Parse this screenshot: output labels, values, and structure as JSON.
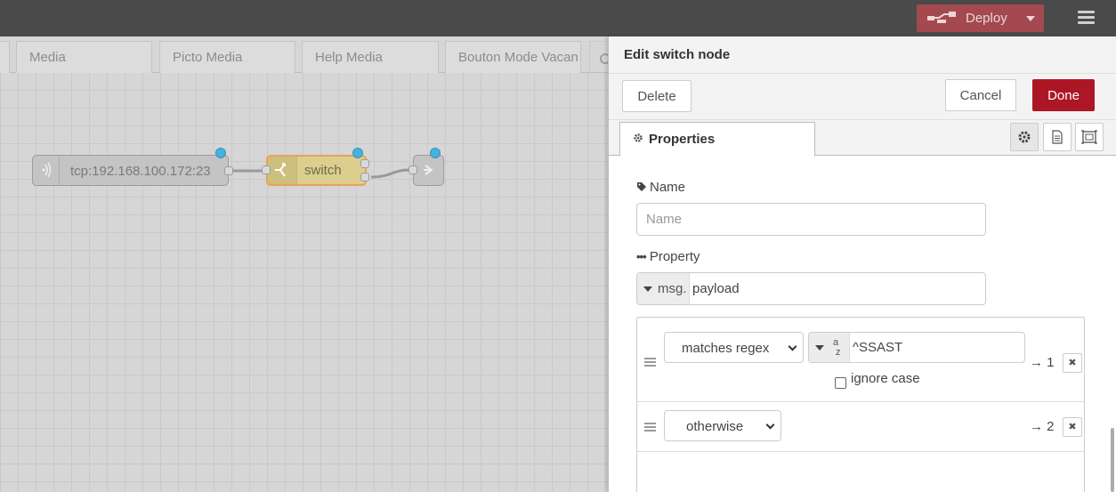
{
  "header": {
    "deploy_label": "Deploy"
  },
  "workspace": {
    "tabs": [
      "Media",
      "Picto Media",
      "Help Media",
      "Bouton Mode Vacan"
    ],
    "nodes": {
      "tcp_label": "tcp:192.168.100.172:23",
      "switch_label": "switch"
    }
  },
  "editor": {
    "title": "Edit switch node",
    "delete_label": "Delete",
    "cancel_label": "Cancel",
    "done_label": "Done",
    "tab_properties": "Properties",
    "name_label": "Name",
    "name_placeholder": "Name",
    "property_label": "Property",
    "property_prefix": "msg.",
    "property_value": "payload",
    "rules": [
      {
        "operator": "matches regex",
        "value": "^SSAST",
        "output": "→ 1",
        "option_label": "ignore case",
        "option_checked": false
      },
      {
        "operator": "otherwise",
        "output": "→ 2"
      }
    ]
  },
  "colors": {
    "header_bg": "#4a4a4a",
    "deploy_bg": "#a3494f",
    "done_bg": "#ad1625",
    "switch_node_bg": "#dccf8e",
    "switch_node_border": "#e8a25a",
    "status_dot": "#47b0de"
  },
  "icons": [
    "deploy-icon",
    "menu-icon",
    "tcp-icon",
    "switch-icon",
    "link-out-icon",
    "cog-icon",
    "tag-icon",
    "ellipsis-icon",
    "description-icon",
    "appearance-icon",
    "drag-handle-icon",
    "remove-icon",
    "caret-down-icon",
    "az-string-icon"
  ]
}
